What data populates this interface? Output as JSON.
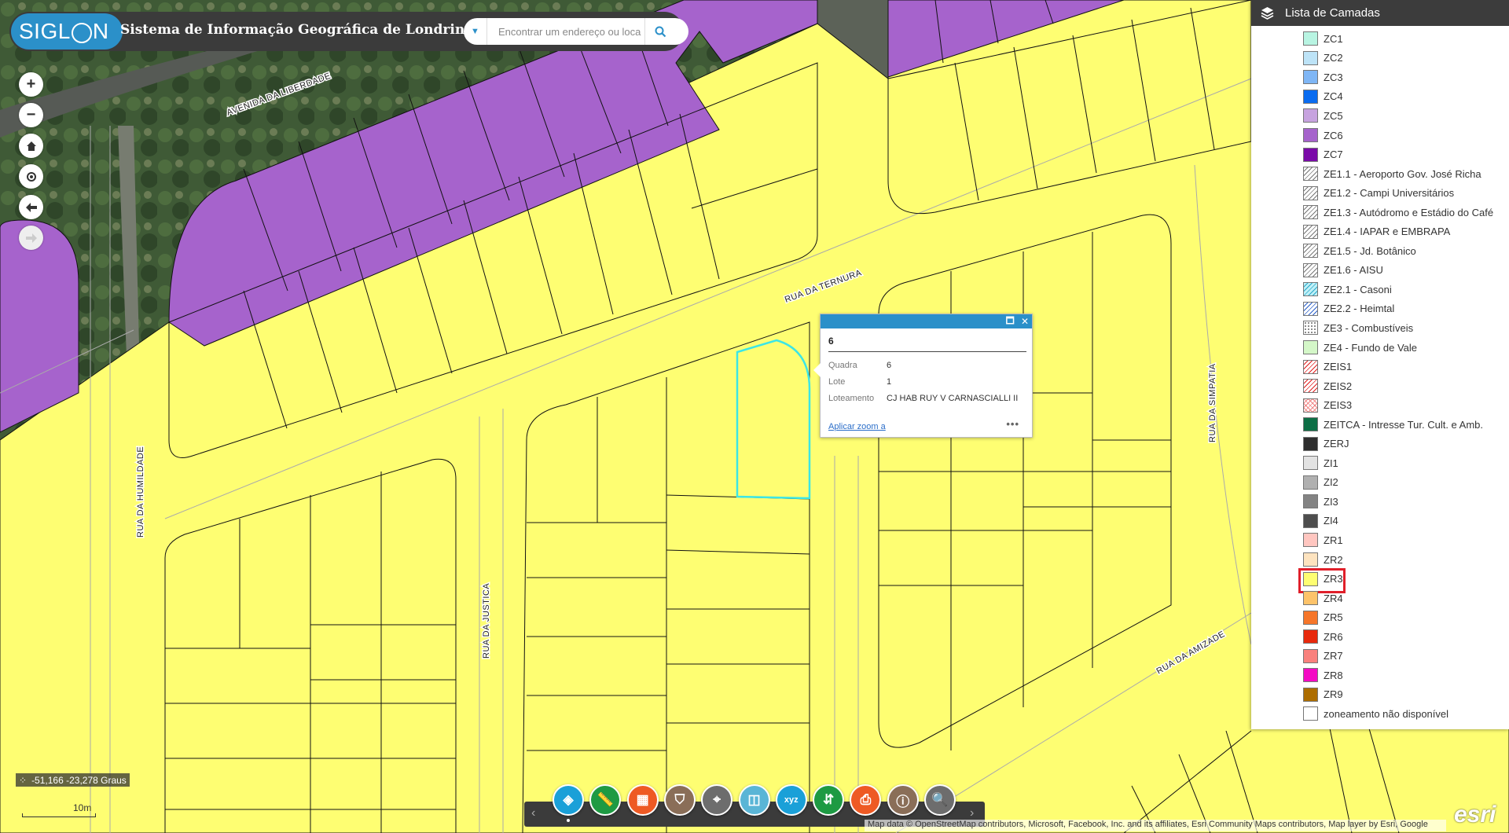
{
  "header": {
    "logo_text": "SIGL",
    "logo_text_end": "N",
    "title": "Sistema de Informação Geográfica de Londrina",
    "search_placeholder": "Encontrar um endereço ou loca"
  },
  "map": {
    "street_labels": [
      "AVENIDA DA LIBERDADE",
      "RUA DA TERNURA",
      "RUA DA HUMILDADE",
      "RUA DA JUSTICA",
      "RUA DA SIMPATIA",
      "RUA DA AMIZADE"
    ],
    "colors": {
      "zr3": "#fefe72",
      "zc6": "#a663cc",
      "highlight": "#3ce6e6"
    }
  },
  "popup": {
    "title": "6",
    "rows": [
      {
        "key": "Quadra",
        "value": "6"
      },
      {
        "key": "Lote",
        "value": "1"
      },
      {
        "key": "Loteamento",
        "value": "CJ HAB RUY V CARNASCIALLI II"
      }
    ],
    "zoom_link": "Aplicar zoom a",
    "more": "•••"
  },
  "layer_list": {
    "title": "Lista de Camadas",
    "items": [
      {
        "label": "ZC1",
        "color": "#b8f4e2"
      },
      {
        "label": "ZC2",
        "color": "#bde3f7"
      },
      {
        "label": "ZC3",
        "color": "#7fb6f5"
      },
      {
        "label": "ZC4",
        "color": "#0a6cf0"
      },
      {
        "label": "ZC5",
        "color": "#c7a3df"
      },
      {
        "label": "ZC6",
        "color": "#a663cc"
      },
      {
        "label": "ZC7",
        "color": "#7a0aa8"
      },
      {
        "label": "ZE1.1 - Aeroporto Gov. José Richa",
        "pattern": "hatch"
      },
      {
        "label": "ZE1.2 - Campi Universitários",
        "pattern": "hatch"
      },
      {
        "label": "ZE1.3 - Autódromo e Estádio do Café",
        "pattern": "hatch"
      },
      {
        "label": "ZE1.4 - IAPAR e EMBRAPA",
        "pattern": "hatch"
      },
      {
        "label": "ZE1.5 - Jd. Botânico",
        "pattern": "hatch"
      },
      {
        "label": "ZE1.6 - AISU",
        "pattern": "hatch"
      },
      {
        "label": "ZE2.1 - Casoni",
        "pattern": "hatch-cyan"
      },
      {
        "label": "ZE2.2 - Heimtal",
        "pattern": "hatch-blue"
      },
      {
        "label": "ZE3 - Combustíveis",
        "pattern": "dots"
      },
      {
        "label": "ZE4 - Fundo de Vale",
        "color": "#d4f7c8"
      },
      {
        "label": "ZEIS1",
        "pattern": "hatch-red"
      },
      {
        "label": "ZEIS2",
        "pattern": "hatch-red"
      },
      {
        "label": "ZEIS3",
        "pattern": "cross-red"
      },
      {
        "label": "ZEITCA - Intresse Tur. Cult. e Amb.",
        "color": "#0c6e45"
      },
      {
        "label": "ZERJ",
        "color": "#2e2e2e"
      },
      {
        "label": "ZI1",
        "color": "#e2e2e2"
      },
      {
        "label": "ZI2",
        "color": "#b0b0b0"
      },
      {
        "label": "ZI3",
        "color": "#838383"
      },
      {
        "label": "ZI4",
        "color": "#4d4d4d"
      },
      {
        "label": "ZR1",
        "color": "#ffc6c0"
      },
      {
        "label": "ZR2",
        "color": "#fde3bf"
      },
      {
        "label": "ZR3",
        "color": "#fefe72",
        "selected": true
      },
      {
        "label": "ZR4",
        "color": "#fdc36a"
      },
      {
        "label": "ZR5",
        "color": "#f6762a"
      },
      {
        "label": "ZR6",
        "color": "#e8290c"
      },
      {
        "label": "ZR7",
        "color": "#f9817d"
      },
      {
        "label": "ZR8",
        "color": "#f40ac4"
      },
      {
        "label": "ZR9",
        "color": "#ad6d00"
      },
      {
        "label": "zoneamento não disponível",
        "color": "#ffffff"
      }
    ]
  },
  "coordinates": "-51,166 -23,278 Graus",
  "scale": "10m",
  "attribution": "Map data © OpenStreetMap contributors, Microsoft, Facebook, Inc. and its affiliates, Esri Community Maps contributors, Map layer by Esri, Google",
  "esri_logo": "esri",
  "tools": [
    {
      "name": "layers-tool",
      "color": "#1aa0d8"
    },
    {
      "name": "measure-tool",
      "color": "#1e9a43"
    },
    {
      "name": "basemap-tool",
      "color": "#ee5a24"
    },
    {
      "name": "filter-tool",
      "color": "#8a6e58"
    },
    {
      "name": "draw-tool",
      "color": "#6d6d6d"
    },
    {
      "name": "swipe-tool",
      "color": "#5ab5d6"
    },
    {
      "name": "xyz-tool",
      "color": "#1aa0d8"
    },
    {
      "name": "share-tool",
      "color": "#1e9a43"
    },
    {
      "name": "print-tool",
      "color": "#ee5a24"
    },
    {
      "name": "info-tool",
      "color": "#8a6e58"
    },
    {
      "name": "query-tool",
      "color": "#6d6d6d"
    }
  ]
}
